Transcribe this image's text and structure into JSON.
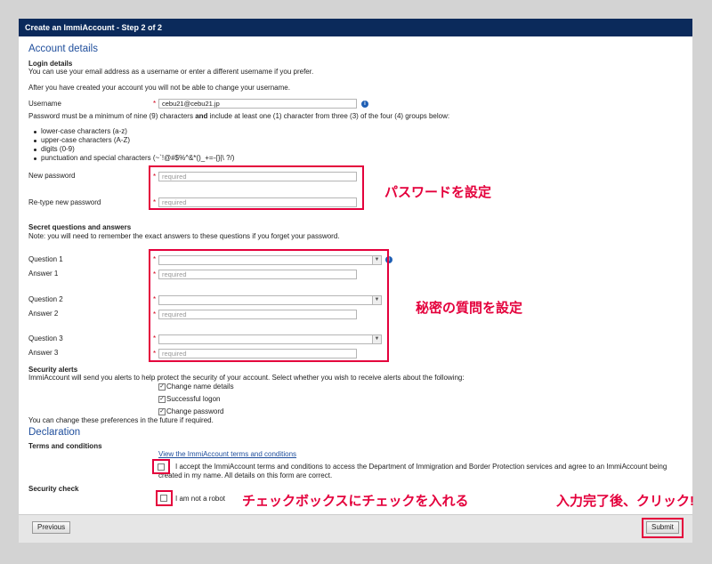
{
  "window": {
    "title": "Create an ImmiAccount - Step 2 of 2"
  },
  "account": {
    "heading": "Account details",
    "login_heading": "Login details",
    "login_note": "You can use your email address as a username or enter a different username if you prefer.",
    "login_note2": "After you have created your account you will not be able to change your username.",
    "username_label": "Username",
    "username_value": "cebu21@cebu21.jp",
    "pw_rule_prefix": "Password must be a minimum of nine (9) characters ",
    "pw_rule_and": "and",
    "pw_rule_suffix": " include at least one (1) character from three (3) of the four (4) groups below:",
    "pw_groups": [
      "lower-case characters (a-z)",
      "upper-case characters (A-Z)",
      "digits (0-9)",
      "punctuation and special characters (~`!@#$%^&*()_+=-{}|\\ ?/)"
    ],
    "new_pw_label": "New password",
    "retype_pw_label": "Re-type new password",
    "placeholder": "required",
    "required_mark": "*"
  },
  "secret": {
    "heading": "Secret questions and answers",
    "note": "Note: you will need to remember the exact answers to these questions if you forget your password.",
    "q1": "Question 1",
    "a1": "Answer 1",
    "q2": "Question 2",
    "a2": "Answer 2",
    "q3": "Question 3",
    "a3": "Answer 3"
  },
  "alerts": {
    "heading": "Security alerts",
    "note": "ImmiAccount will send you alerts to help protect the security of your account. Select whether you wish to receive alerts about the following:",
    "options": [
      "Change name details",
      "Successful logon",
      "Change password"
    ],
    "footer_note": "You can change these preferences in the future if required."
  },
  "declaration": {
    "heading": "Declaration",
    "terms_heading": "Terms and conditions",
    "terms_link": "View the ImmiAccount terms and conditions",
    "accept_text_1": "I accept the ImmiAccount terms and conditions to access the Department of Immigration and Border Protection services and agree to an ImmiAccount being",
    "accept_text_2": "created in my name. All details on this form are correct.",
    "security_heading": "Security check",
    "robot_label": "I am not a robot"
  },
  "annotations": {
    "password": "パスワードを設定",
    "secret": "秘密の質問を設定",
    "checkbox": "チェックボックスにチェックを入れる",
    "submit": "入力完了後、クリック!"
  },
  "footer": {
    "previous": "Previous",
    "submit": "Submit"
  },
  "icons": {
    "info": "info-icon",
    "dropdown": "chevron-down-icon",
    "check": "checkmark-icon"
  },
  "colors": {
    "titlebar": "#0b2a5b",
    "heading": "#1f4e9c",
    "annotation": "#e4003c",
    "required": "#d0021b"
  }
}
